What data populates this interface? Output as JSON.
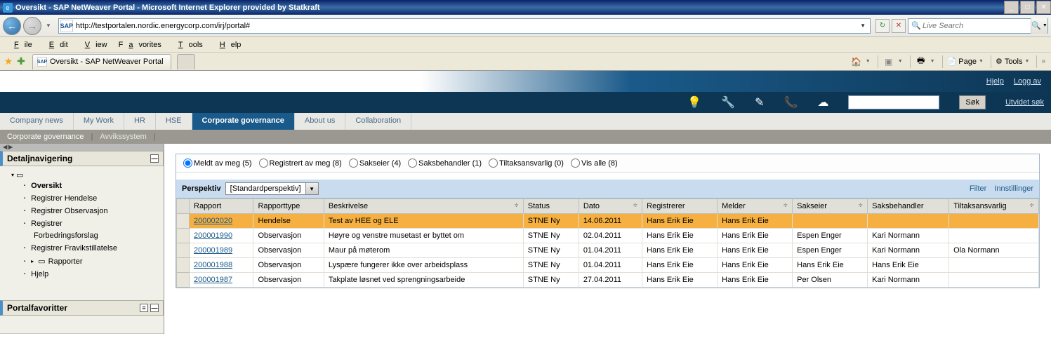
{
  "window_title": "Oversikt - SAP NetWeaver Portal - Microsoft Internet Explorer provided by Statkraft",
  "url": "http://testportalen.nordic.energycorp.com/irj/portal#",
  "search_placeholder": "Live Search",
  "menubar": {
    "file": "File",
    "edit": "Edit",
    "view": "View",
    "favorites": "Favorites",
    "tools": "Tools",
    "help": "Help"
  },
  "tab_title": "Oversikt - SAP NetWeaver Portal",
  "ie_tools": {
    "page": "Page",
    "tools": "Tools"
  },
  "sap_links": {
    "help": "Hjelp",
    "logoff": "Logg av"
  },
  "sap_search_btn": "Søk",
  "sap_adv_search": "Utvidet søk",
  "toptabs": {
    "items": [
      "Company news",
      "My Work",
      "HR",
      "HSE",
      "Corporate governance",
      "About us",
      "Collaboration"
    ],
    "active_index": 4
  },
  "breadcrumb": {
    "a": "Corporate governance",
    "b": "Avvikssystem"
  },
  "sidebar": {
    "title": "Detaljnavigering",
    "items": {
      "oversikt": "Oversikt",
      "reg_hendelse": "Registrer Hendelse",
      "reg_observasjon": "Registrer Observasjon",
      "reg_forbedring_a": "Registrer",
      "reg_forbedring_b": "Forbedringsforslag",
      "reg_fravik": "Registrer Fravikstillatelse",
      "rapporter": "Rapporter",
      "hjelp": "Hjelp"
    },
    "portalfav": "Portalfavoritter"
  },
  "filters": {
    "meldt": "Meldt av meg (5)",
    "registrert": "Registrert av meg (8)",
    "sakseier": "Sakseier (4)",
    "saksbehandler": "Saksbehandler (1)",
    "tiltak": "Tiltaksansvarlig (0)",
    "visalle": "Vis alle (8)"
  },
  "perspektiv": {
    "label": "Perspektiv",
    "value": "[Standardperspektiv]",
    "filter_link": "Filter",
    "settings_link": "Innstillinger"
  },
  "columns": {
    "rapport": "Rapport",
    "rapporttype": "Rapporttype",
    "beskrivelse": "Beskrivelse",
    "status": "Status",
    "dato": "Dato",
    "registrerer": "Registrerer",
    "melder": "Melder",
    "sakseier": "Sakseier",
    "saksbehandler": "Saksbehandler",
    "tiltaksansvarlig": "Tiltaksansvarlig"
  },
  "rows": [
    {
      "rapport": "200002020",
      "type": "Hendelse",
      "beskr": "Test av HEE og ELE",
      "status": "STNE Ny",
      "dato": "14.06.2011",
      "reg": "Hans Erik Eie",
      "melder": "Hans Erik Eie",
      "sakseier": "",
      "saksb": "",
      "tiltak": ""
    },
    {
      "rapport": "200001990",
      "type": "Observasjon",
      "beskr": "Høyre og venstre musetast er byttet om",
      "status": "STNE Ny",
      "dato": "02.04.2011",
      "reg": "Hans Erik Eie",
      "melder": "Hans Erik Eie",
      "sakseier": "Espen Enger",
      "saksb": "Kari Normann",
      "tiltak": ""
    },
    {
      "rapport": "200001989",
      "type": "Observasjon",
      "beskr": "Maur på møterom",
      "status": "STNE Ny",
      "dato": "01.04.2011",
      "reg": "Hans Erik Eie",
      "melder": "Hans Erik Eie",
      "sakseier": "Espen Enger",
      "saksb": "Kari Normann",
      "tiltak": "Ola Normann"
    },
    {
      "rapport": "200001988",
      "type": "Observasjon",
      "beskr": "Lyspære fungerer ikke over arbeidsplass",
      "status": "STNE Ny",
      "dato": "01.04.2011",
      "reg": "Hans Erik Eie",
      "melder": "Hans Erik Eie",
      "sakseier": "Hans Erik Eie",
      "saksb": "Hans Erik Eie",
      "tiltak": ""
    },
    {
      "rapport": "200001987",
      "type": "Observasjon",
      "beskr": "Takplate løsnet ved sprengningsarbeide",
      "status": "STNE Ny",
      "dato": "27.04.2011",
      "reg": "Hans Erik Eie",
      "melder": "Hans Erik Eie",
      "sakseier": "Per Olsen",
      "saksb": "Kari Normann",
      "tiltak": ""
    }
  ]
}
